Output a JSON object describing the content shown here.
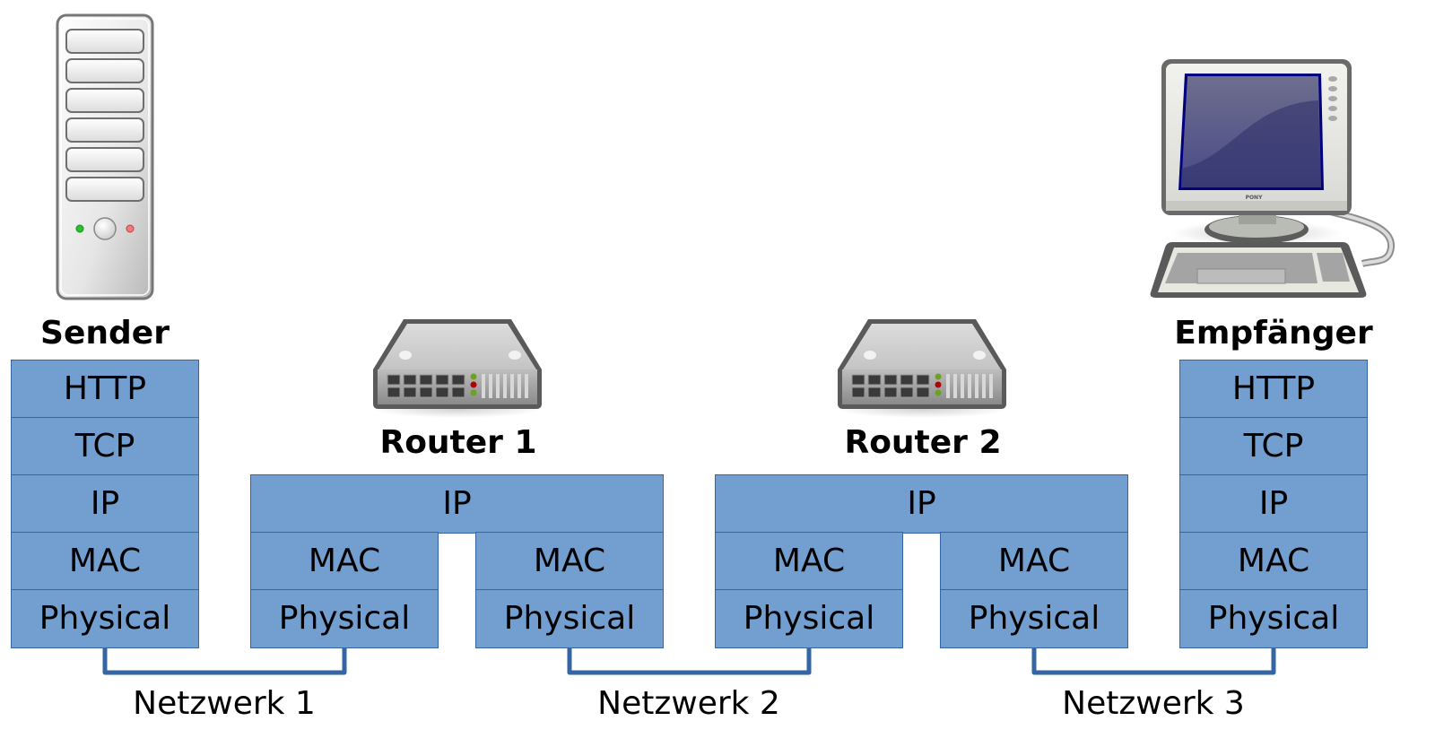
{
  "colors": {
    "layer_fill": "#729fcf",
    "layer_border": "#3465a4",
    "connector": "#3465a4"
  },
  "sender": {
    "title": "Sender",
    "icon": "server-tower-icon",
    "layers": [
      "HTTP",
      "TCP",
      "IP",
      "MAC",
      "Physical"
    ]
  },
  "router1": {
    "title": "Router 1",
    "icon": "router-icon",
    "ip": "IP",
    "left": {
      "mac": "MAC",
      "physical": "Physical"
    },
    "right": {
      "mac": "MAC",
      "physical": "Physical"
    }
  },
  "router2": {
    "title": "Router 2",
    "icon": "router-icon",
    "ip": "IP",
    "left": {
      "mac": "MAC",
      "physical": "Physical"
    },
    "right": {
      "mac": "MAC",
      "physical": "Physical"
    }
  },
  "receiver": {
    "title": "Empfänger",
    "icon": "desktop-computer-icon",
    "monitor_brand": "PONY",
    "layers": [
      "HTTP",
      "TCP",
      "IP",
      "MAC",
      "Physical"
    ]
  },
  "networks": [
    {
      "label": "Netzwerk 1"
    },
    {
      "label": "Netzwerk 2"
    },
    {
      "label": "Netzwerk 3"
    }
  ]
}
